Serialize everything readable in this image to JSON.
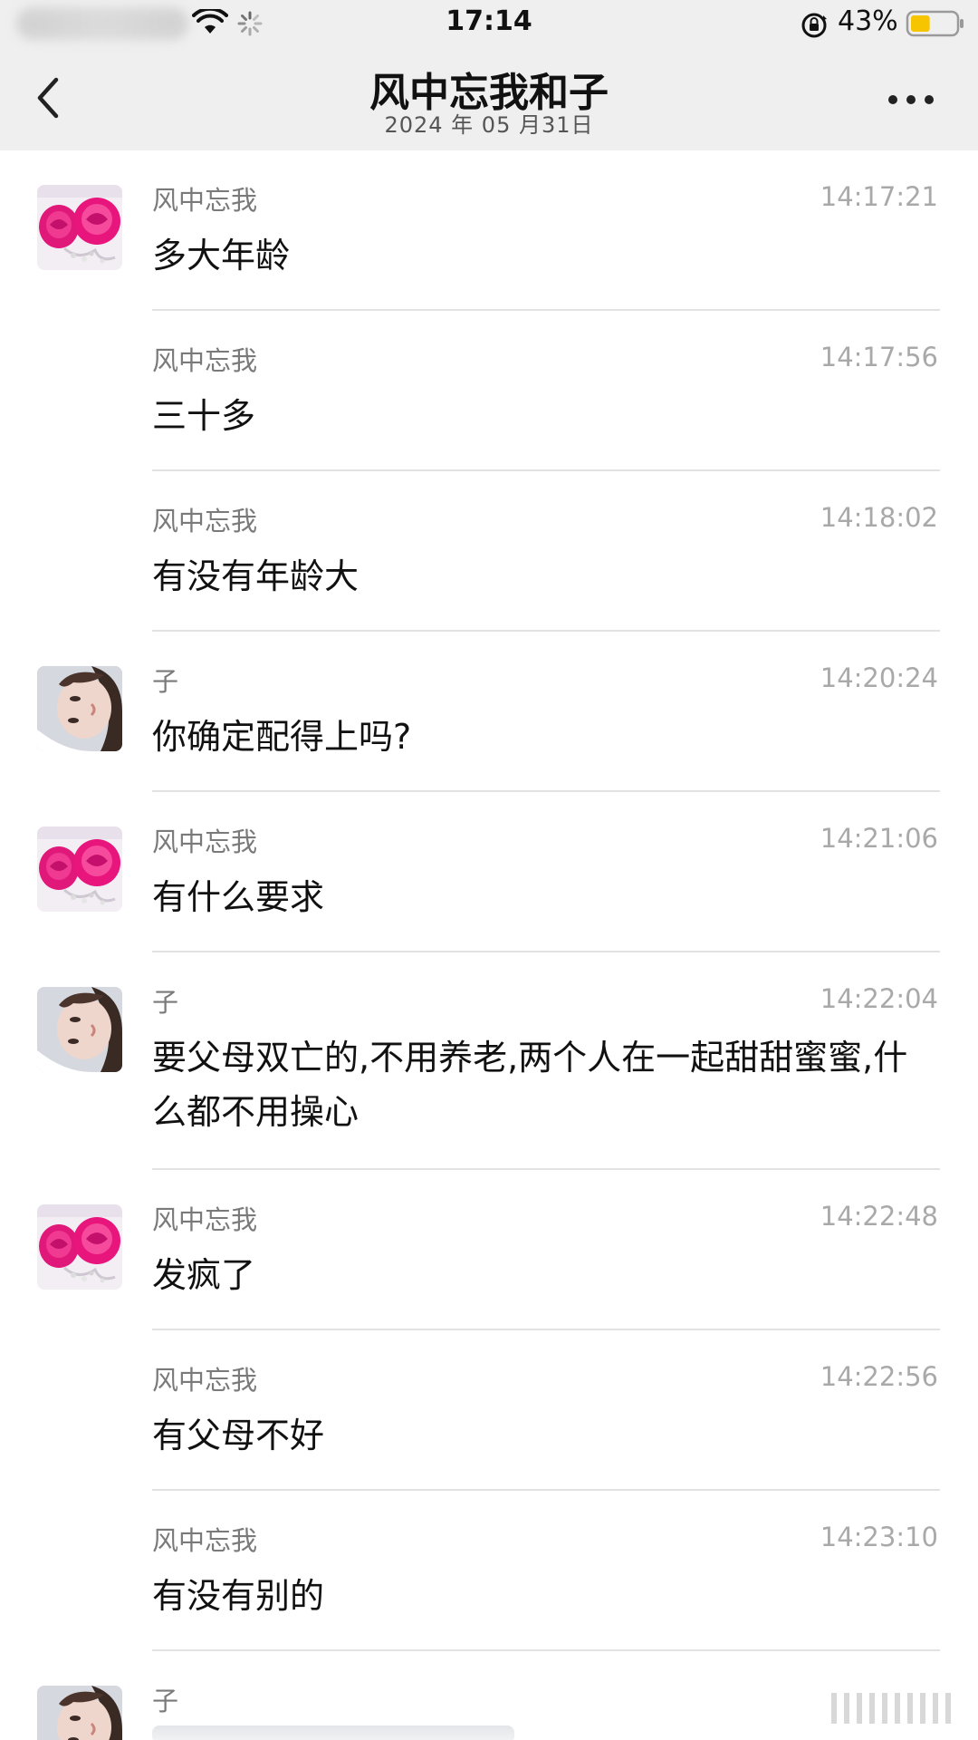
{
  "status_bar": {
    "time": "17:14",
    "battery_percent": "43%",
    "battery_level": 0.43,
    "battery_color": "#f7c500"
  },
  "nav": {
    "title": "风中忘我和子",
    "subtitle": "2024 年 05 月31日",
    "back_icon": "chevron-left-icon",
    "more_icon": "more-dots-icon"
  },
  "colors": {
    "header_bg": "#efefef",
    "sender": "#7a7a7a",
    "timestamp": "#a9a9a9",
    "divider": "#e2e2e2"
  },
  "messages": [
    {
      "sender": "风中忘我",
      "time": "14:17:21",
      "text": "多大年龄",
      "avatar": "rose"
    },
    {
      "sender": "风中忘我",
      "time": "14:17:56",
      "text": "三十多",
      "avatar": "none"
    },
    {
      "sender": "风中忘我",
      "time": "14:18:02",
      "text": "有没有年龄大",
      "avatar": "none"
    },
    {
      "sender": "子",
      "time": "14:20:24",
      "text": "你确定配得上吗?",
      "avatar": "portrait"
    },
    {
      "sender": "风中忘我",
      "time": "14:21:06",
      "text": "有什么要求",
      "avatar": "rose"
    },
    {
      "sender": "子",
      "time": "14:22:04",
      "text": "要父母双亡的,不用养老,两个人在一起甜甜蜜蜜,什么都不用操心",
      "avatar": "portrait"
    },
    {
      "sender": "风中忘我",
      "time": "14:22:48",
      "text": "发疯了",
      "avatar": "rose"
    },
    {
      "sender": "风中忘我",
      "time": "14:22:56",
      "text": "有父母不好",
      "avatar": "none"
    },
    {
      "sender": "风中忘我",
      "time": "14:23:10",
      "text": "有没有别的",
      "avatar": "none"
    },
    {
      "sender": "子",
      "time": "",
      "text": "",
      "avatar": "portrait"
    }
  ]
}
